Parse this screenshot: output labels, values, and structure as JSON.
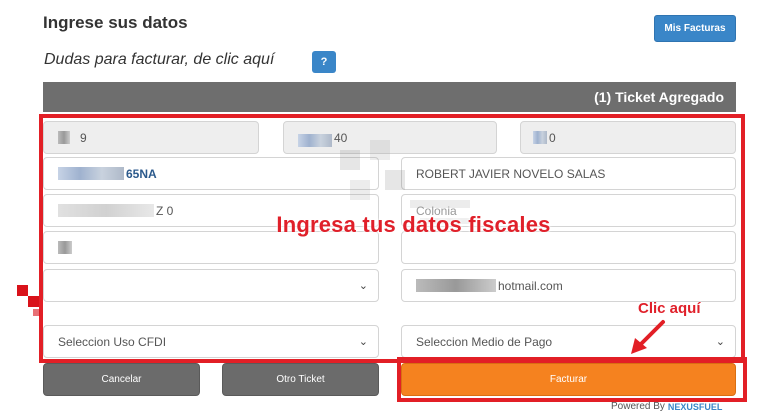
{
  "header": {
    "title": "Ingrese sus datos",
    "mis_facturas_label": "Mis Facturas",
    "dudas_text": "Dudas para facturar, de clic aquí",
    "help_label": "?"
  },
  "ticket_bar": {
    "label": "(1) Ticket Agregado"
  },
  "form": {
    "ticket_field_1": "9",
    "ticket_field_2": "40",
    "ticket_field_3": "0",
    "rfc_value": "65NA",
    "name_value": "ROBERT JAVIER NOVELO SALAS",
    "address_value": "Z 0",
    "colonia_placeholder": "Colonia",
    "email_value": "hotmail.com",
    "uso_cfdi_label": "Seleccion Uso CFDI",
    "medio_pago_label": "Seleccion Medio de Pago"
  },
  "annotations": {
    "overlay_text": "Ingresa tus datos fiscales",
    "clic_aqui": "Clic aquí",
    "accent_color": "#e21f26"
  },
  "buttons": {
    "cancelar": "Cancelar",
    "otro_ticket": "Otro Ticket",
    "facturar": "Facturar"
  },
  "footer": {
    "powered_by": "Powered By",
    "brand": "NEXUSFUEL"
  }
}
